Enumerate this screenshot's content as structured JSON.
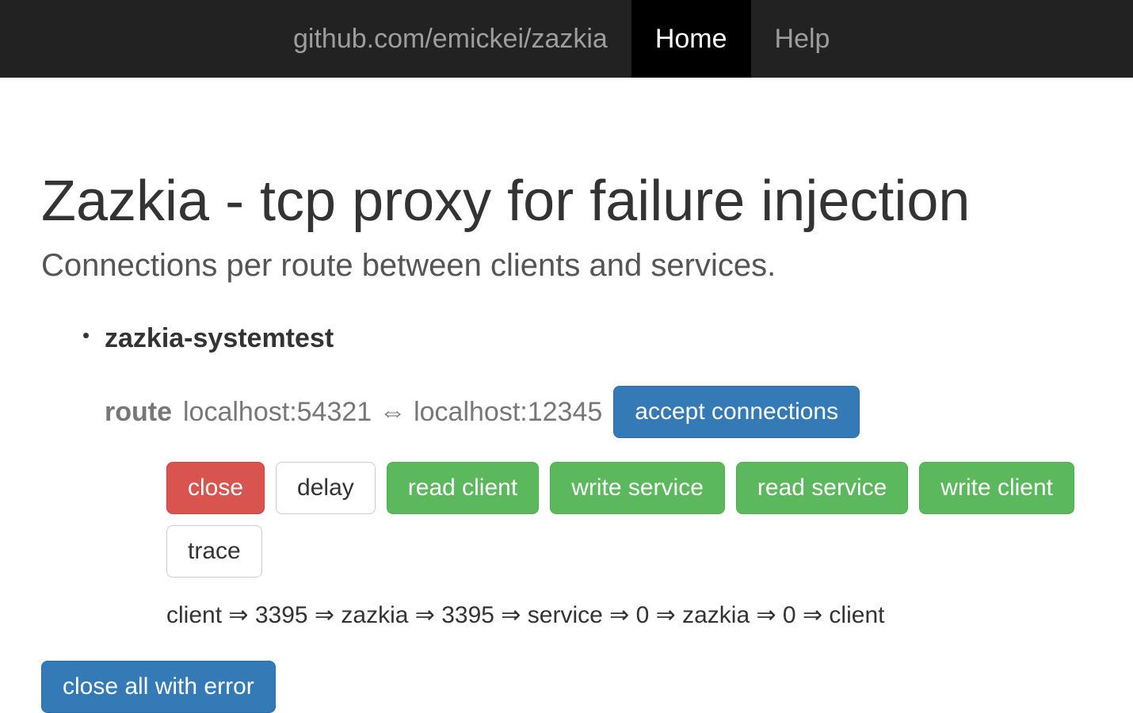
{
  "navbar": {
    "brand": "github.com/emickei/zazkia",
    "links": [
      {
        "label": "Home",
        "active": true
      },
      {
        "label": "Help",
        "active": false
      }
    ]
  },
  "page": {
    "title": "Zazkia - tcp proxy for failure injection",
    "subtitle": "Connections per route between clients and services."
  },
  "routes": [
    {
      "name": "zazkia-systemtest",
      "label_prefix": "route",
      "endpoints": "localhost:54321 ⇔ localhost:12345",
      "accept_label": "accept connections",
      "actions": {
        "close": "close",
        "delay": "delay",
        "read_client": "read client",
        "write_service": "write service",
        "read_service": "read service",
        "write_client": "write client",
        "trace": "trace"
      },
      "flow": "client ⇒ 3395 ⇒ zazkia ⇒ 3395 ⇒ service ⇒ 0 ⇒ zazkia ⇒ 0 ⇒ client"
    }
  ],
  "close_all_label": "close all with error"
}
